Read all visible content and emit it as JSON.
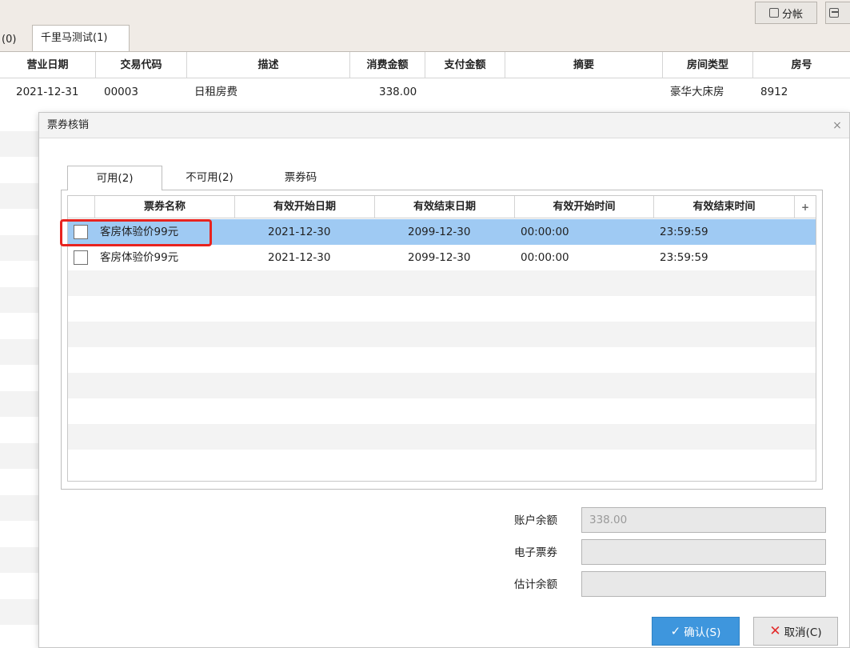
{
  "toolbar": {
    "split_label": "分帐"
  },
  "bg_tabs": {
    "prev_count": "(0)",
    "active": "千里马测试(1)"
  },
  "folio": {
    "headers": [
      "营业日期",
      "交易代码",
      "描述",
      "消费金额",
      "支付金额",
      "摘要",
      "房间类型",
      "房号"
    ],
    "row": {
      "date": "2021-12-31",
      "code": "00003",
      "desc": "日租房费",
      "amount": "338.00",
      "payment": "",
      "summary": "",
      "room_type": "豪华大床房",
      "room_no": "8912"
    }
  },
  "dialog": {
    "title": "票券核销",
    "close": "×",
    "tabs": [
      "可用(2)",
      "不可用(2)",
      "票券码"
    ],
    "grid": {
      "headers": [
        "票券名称",
        "有效开始日期",
        "有效结束日期",
        "有效开始时间",
        "有效结束时间"
      ],
      "add_col": "+",
      "rows": [
        {
          "name": "客房体验价99元",
          "start_date": "2021-12-30",
          "end_date": "2099-12-30",
          "start_time": "00:00:00",
          "end_time": "23:59:59"
        },
        {
          "name": "客房体验价99元",
          "start_date": "2021-12-30",
          "end_date": "2099-12-30",
          "start_time": "00:00:00",
          "end_time": "23:59:59"
        }
      ]
    },
    "summary": {
      "balance_label": "账户余额",
      "balance_value": "338.00",
      "ecoupon_label": "电子票券",
      "ecoupon_value": "",
      "estimate_label": "估计余额",
      "estimate_value": ""
    },
    "buttons": {
      "confirm": "确认(S)",
      "cancel": "取消(C)"
    }
  },
  "colors": {
    "selected_row": "#9fcaf3",
    "highlight": "#e8231f",
    "confirm_button": "#3e96dd"
  }
}
